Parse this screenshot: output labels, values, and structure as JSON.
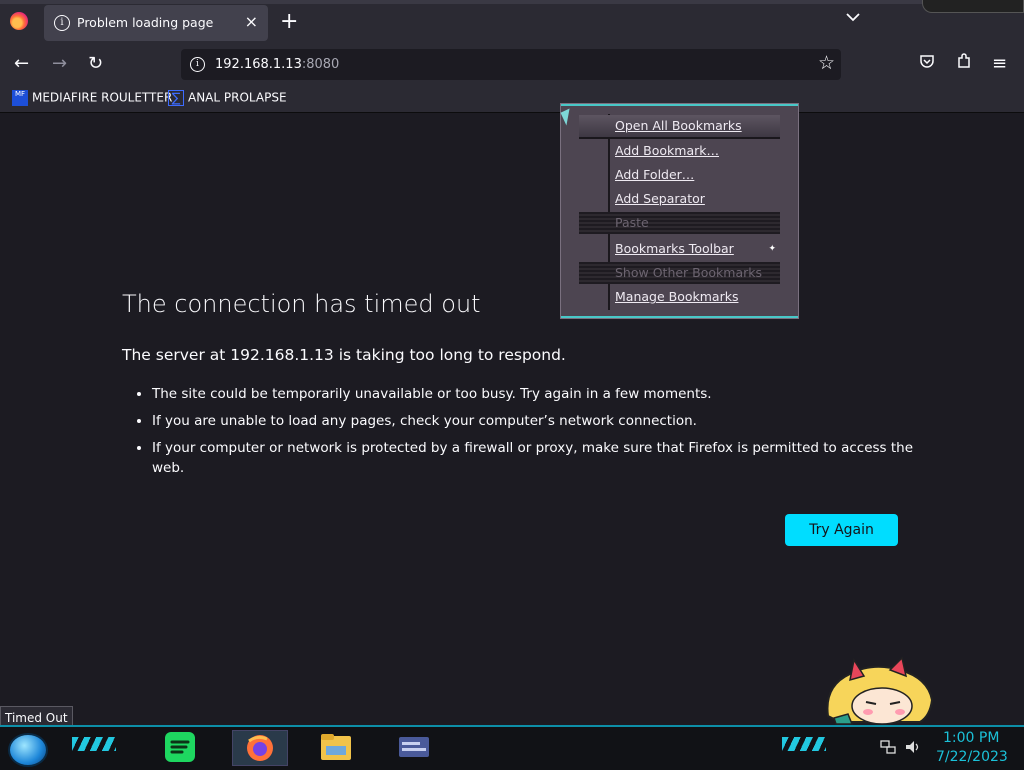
{
  "tab": {
    "title": "Problem loading page",
    "close": "×",
    "new_tab": "+",
    "list_all_tabs": "⌄"
  },
  "nav": {
    "back": "←",
    "forward": "→",
    "reload": "↻",
    "url_host": "192.168.1.13",
    "url_port": ":8080",
    "bookmark_star": "☆",
    "pocket": "◫",
    "extensions": "⧉",
    "menu": "≡"
  },
  "bookmarks_bar": [
    {
      "label": "MEDIAFIRE ROULETTER",
      "icon": "mediafire-icon",
      "icon_text": "MF"
    },
    {
      "label": "ANAL PROLAPSE",
      "icon": "sigma-icon",
      "icon_text": "∑"
    }
  ],
  "error": {
    "title": "The connection has timed out",
    "subtitle": "The server at 192.168.1.13 is taking too long to respond.",
    "bullets": [
      "The site could be temporarily unavailable or too busy. Try again in a few moments.",
      "If you are unable to load any pages, check your computer’s network connection.",
      "If your computer or network is protected by a firewall or proxy, make sure that Firefox is permitted to access the web."
    ],
    "button": "Try Again"
  },
  "context_menu": {
    "items": [
      {
        "label": "Open All Bookmarks",
        "state": "selected"
      },
      {
        "label": "Add Bookmark…",
        "state": "normal"
      },
      {
        "label": "Add Folder…",
        "state": "normal"
      },
      {
        "label": "Add Separator",
        "state": "normal"
      },
      {
        "label": "Paste",
        "state": "disabled"
      },
      {
        "label": "Bookmarks Toolbar",
        "state": "normal",
        "submenu": "✦"
      },
      {
        "label": "Show Other Bookmarks",
        "state": "disabled"
      },
      {
        "label": "Manage Bookmarks",
        "state": "normal"
      }
    ]
  },
  "status_text": "Timed Out",
  "taskbar": {
    "time": "1:00 PM",
    "date": "7/22/2023",
    "apps": [
      "spotify-icon",
      "firefox-icon",
      "file-explorer-icon",
      "window-app-icon"
    ],
    "tray": [
      "network-icon",
      "volume-icon"
    ]
  },
  "colors": {
    "accent": "#00ddff",
    "page_bg": "#1c1b22",
    "toolbar_bg": "#2b2a33",
    "clock": "#1bc1d8"
  }
}
